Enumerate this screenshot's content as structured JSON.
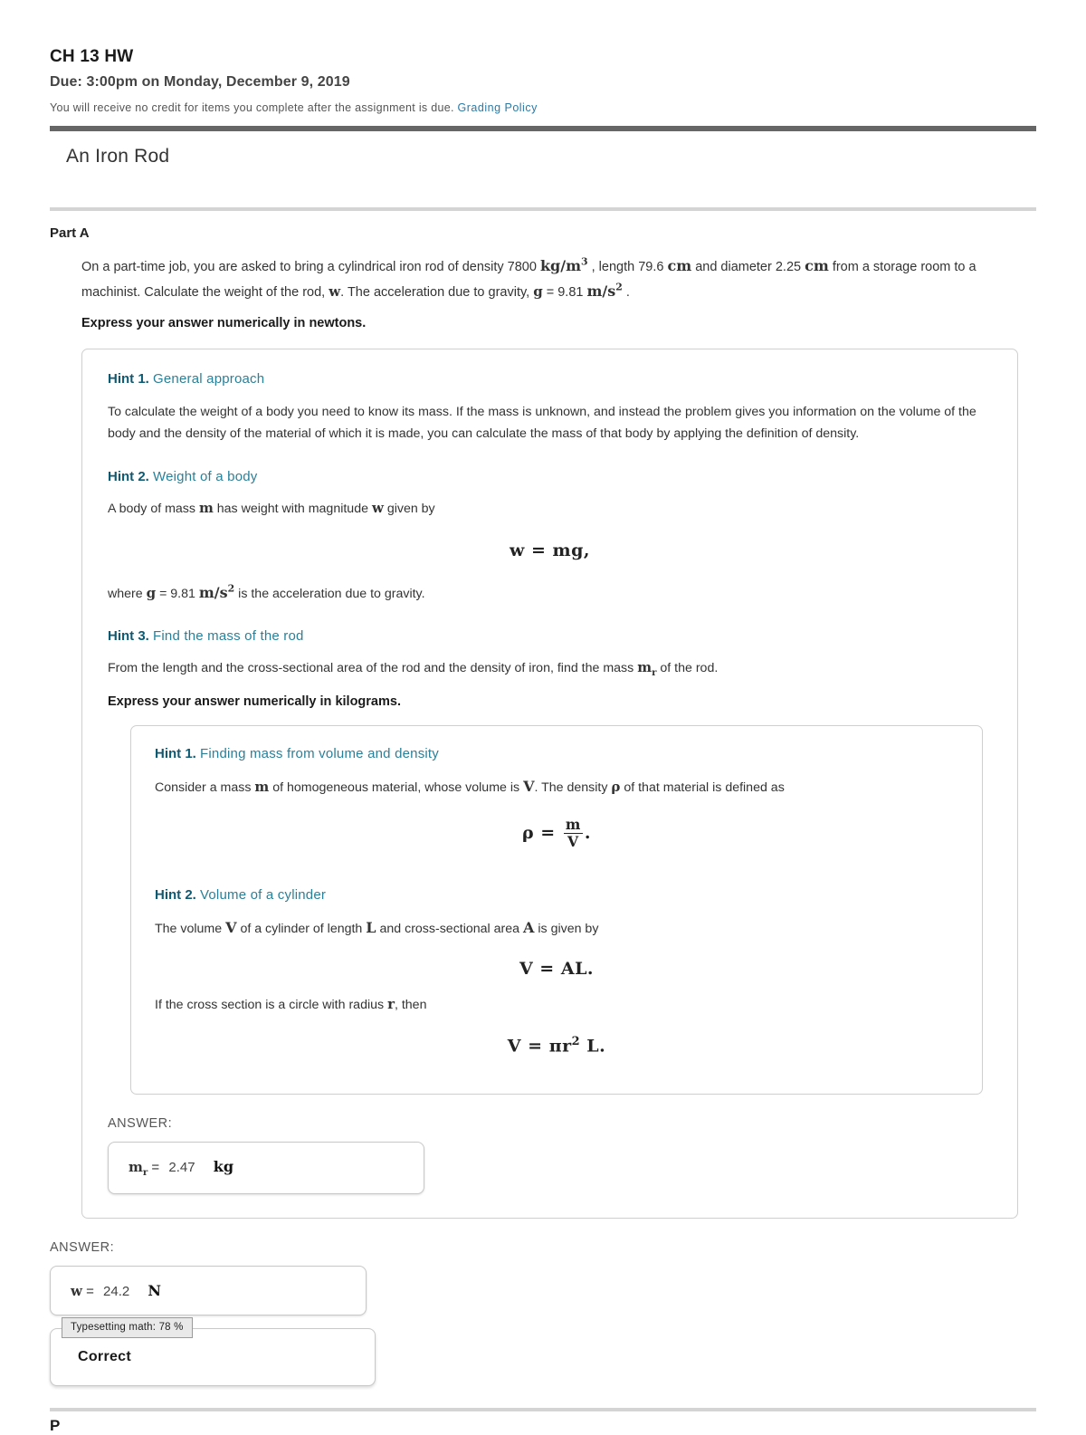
{
  "header": {
    "title": "CH 13 HW",
    "due": "Due: 3:00pm on Monday, December 9, 2019",
    "note": "You will receive no credit for items you complete after the assignment is due.",
    "grading_policy_link": "Grading Policy"
  },
  "problem": {
    "title": "An Iron Rod",
    "part_label": "Part A",
    "statement_part1": "On a part-time job, you are asked to bring a cylindrical iron rod of density 7800",
    "density_unit": "kg/m",
    "density_exp": "3",
    "statement_part2": ", length 79.6",
    "length_unit": "cm",
    "statement_part3": "and diameter 2.25",
    "diameter_unit": "cm",
    "statement_part4": "from a storage room to a machinist. Calculate the weight of the rod,",
    "sym_w": "w",
    "statement_part5": ". The acceleration due to gravity,",
    "sym_g": "g",
    "statement_part6": "= 9.81",
    "gravity_unit": "m/s",
    "gravity_exp": "2",
    "statement_part7": ".",
    "express_instruction": "Express your answer numerically in newtons."
  },
  "hints": {
    "hint1": {
      "number": "Hint 1.",
      "title": "General approach",
      "body": "To calculate the weight of a body you need to know its mass. If the mass is unknown, and instead the problem gives you information on the volume of the body and the density of the material of which it is made, you can calculate the mass of that body by applying the definition of density."
    },
    "hint2": {
      "number": "Hint 2.",
      "title": "Weight of a body",
      "body_pre": "A body of mass",
      "sym_m": "m",
      "body_mid": "has weight with magnitude",
      "sym_w": "w",
      "body_post": "given by",
      "equation_lhs": "w",
      "equation_eq": "=",
      "equation_rhs": "mg",
      "equation_punct": ",",
      "where_pre": "where",
      "where_sym_g": "g",
      "where_val": "= 9.81",
      "where_unit": "m/s",
      "where_exp": "2",
      "where_post": "is the acceleration due to gravity."
    },
    "hint3": {
      "number": "Hint 3.",
      "title": "Find the mass of the rod",
      "body_pre": "From the length and the cross-sectional area of the rod and the density of iron, find the mass",
      "sym_mr": "m",
      "sym_mr_sub": "r",
      "body_post": "of the rod.",
      "express_instruction": "Express your answer numerically in kilograms.",
      "subhint1": {
        "number": "Hint 1.",
        "title": "Finding mass from volume and density",
        "body_pre": "Consider a mass",
        "sym_m": "m",
        "body_mid": "of homogeneous material, whose volume is",
        "sym_V": "V",
        "body_mid2": ". The density",
        "sym_rho": "ρ",
        "body_post": "of that material is defined as",
        "eq_rho": "ρ",
        "eq_eq": "=",
        "eq_num": "m",
        "eq_den": "V",
        "eq_punct": "."
      },
      "subhint2": {
        "number": "Hint 2.",
        "title": "Volume of a cylinder",
        "body_pre": "The volume",
        "sym_V": "V",
        "body_mid": "of a cylinder of length",
        "sym_L": "L",
        "body_mid2": "and cross-sectional area",
        "sym_A": "A",
        "body_post": "is given by",
        "eq1": "V = AL.",
        "body2_pre": "If the cross section is a circle with radius",
        "sym_r": "r",
        "body2_post": ", then",
        "eq2_lhs": "V",
        "eq2_eq": "=",
        "eq2_pi": "π",
        "eq2_r": "r",
        "eq2_exp": "2",
        "eq2_L": "L",
        "eq2_punct": "."
      },
      "answer_label": "ANSWER:",
      "answer_symbol": "m",
      "answer_symbol_sub": "r",
      "answer_equals": "=",
      "answer_value": "2.47",
      "answer_unit": "kg"
    }
  },
  "answer": {
    "label": "ANSWER:",
    "symbol": "w",
    "equals": "=",
    "value": "24.2",
    "unit": "N",
    "feedback": "Correct"
  },
  "footer": {
    "partial_label": "P",
    "status": "Typesetting math: 78 %"
  }
}
